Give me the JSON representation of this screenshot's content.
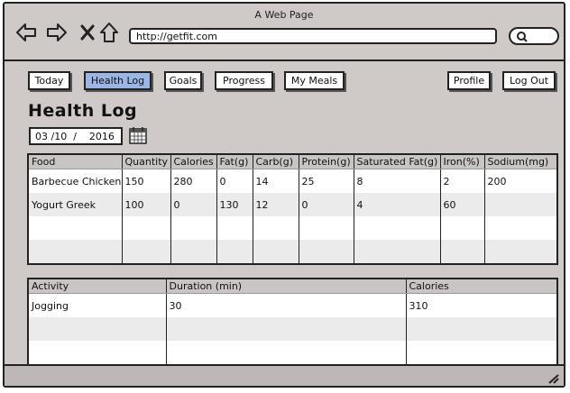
{
  "window": {
    "title": "A Web Page"
  },
  "browser": {
    "url": "http://getfit.com",
    "icons": [
      "back-arrow-icon",
      "forward-arrow-icon",
      "close-icon",
      "home-icon",
      "search-icon"
    ]
  },
  "nav": {
    "today": "Today",
    "health_log": "Health Log",
    "goals": "Goals",
    "progress": "Progress",
    "my_meals": "My Meals",
    "profile": "Profile",
    "log_out": "Log Out"
  },
  "page": {
    "title": "Health Log",
    "date": "03 /10  /    2016"
  },
  "food_table": {
    "headers": [
      "Food",
      "Quantity",
      "Calories",
      "Fat(g)",
      "Carb(g)",
      "Protein(g)",
      "Saturated Fat(g)",
      "Iron(%)",
      "Sodium(mg)"
    ],
    "rows": [
      [
        "Barbecue Chicken",
        "150",
        "280",
        "0",
        "14",
        " 25",
        "8",
        "2",
        "200"
      ],
      [
        "Yogurt Greek",
        "100",
        "0",
        "130",
        " 12",
        "0",
        "4",
        "60",
        ""
      ],
      [
        "",
        "",
        "",
        "",
        "",
        "",
        "",
        "",
        ""
      ],
      [
        "",
        "",
        "",
        "",
        "",
        "",
        "",
        "",
        ""
      ]
    ]
  },
  "activity_table": {
    "headers": [
      "Activity",
      "Duration (min)",
      "Calories"
    ],
    "rows": [
      [
        "Jogging",
        "30",
        "310"
      ],
      [
        "",
        "",
        ""
      ],
      [
        "",
        "",
        ""
      ]
    ]
  },
  "colors": {
    "window_bg": "#cfc9c8",
    "active_tab": "#9ab6e4",
    "header_bg": "#c9c5c4"
  }
}
